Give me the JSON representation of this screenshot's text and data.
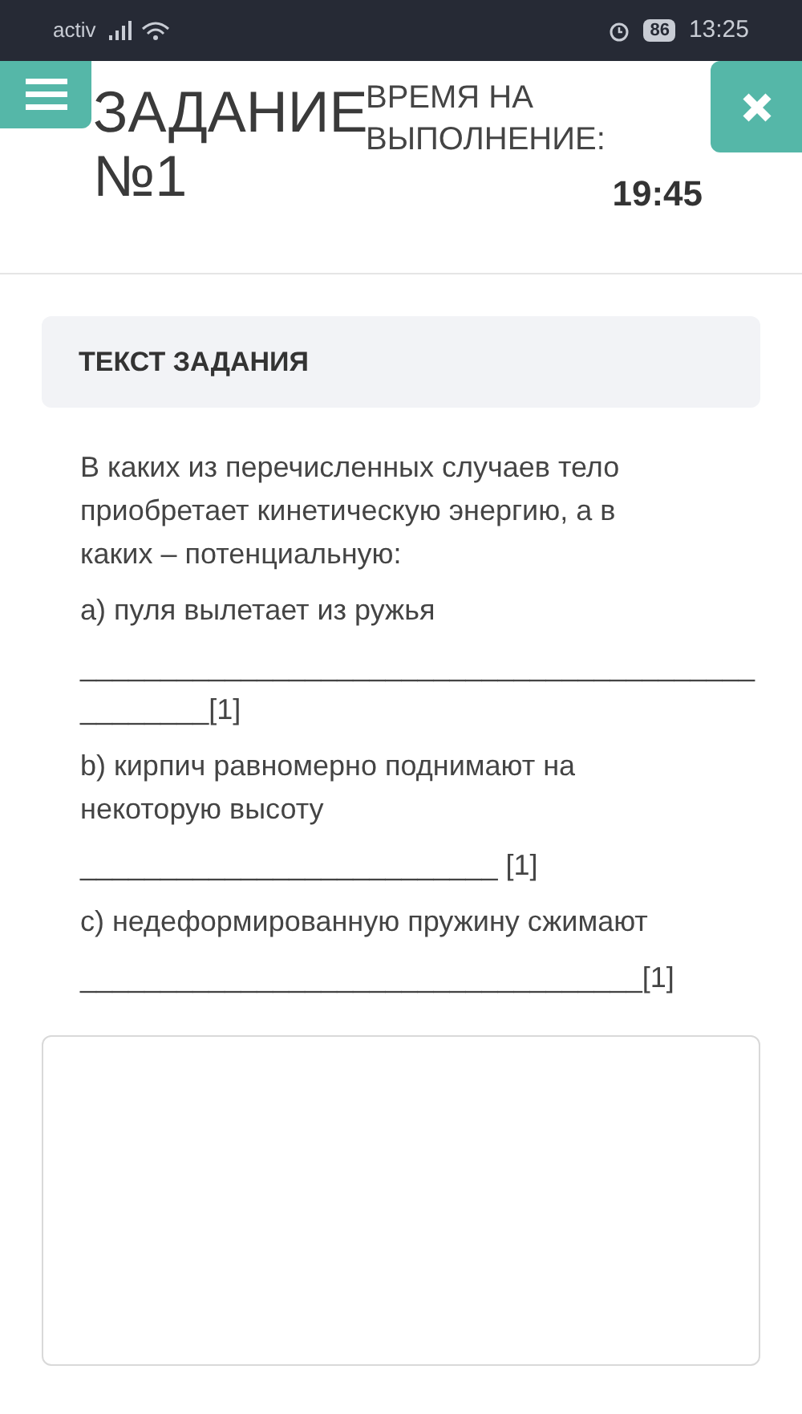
{
  "status_bar": {
    "carrier": "activ",
    "battery": "86",
    "time": "13:25"
  },
  "header": {
    "title": "ЗАДАНИЕ №1",
    "timer_label": "ВРЕМЯ НА ВЫПОЛНЕНИЕ:",
    "timer": "19:45"
  },
  "task": {
    "heading": "ТЕКСТ ЗАДАНИЯ",
    "question": "В каких из перечисленных случаев тело приобретает кинетическую энергию, а в каких – потенциальную:",
    "items": [
      {
        "text": "a) пуля вылетает из ружья",
        "blank": [
          "__________________________________________",
          "________[1]"
        ]
      },
      {
        "text": "b) кирпич равномерно поднимают на некоторую высоту",
        "blank": [
          "__________________________ [1]"
        ]
      },
      {
        "text": "c) недеформированную пружину сжимают",
        "blank": [
          "___________________________________[1]"
        ]
      }
    ]
  }
}
